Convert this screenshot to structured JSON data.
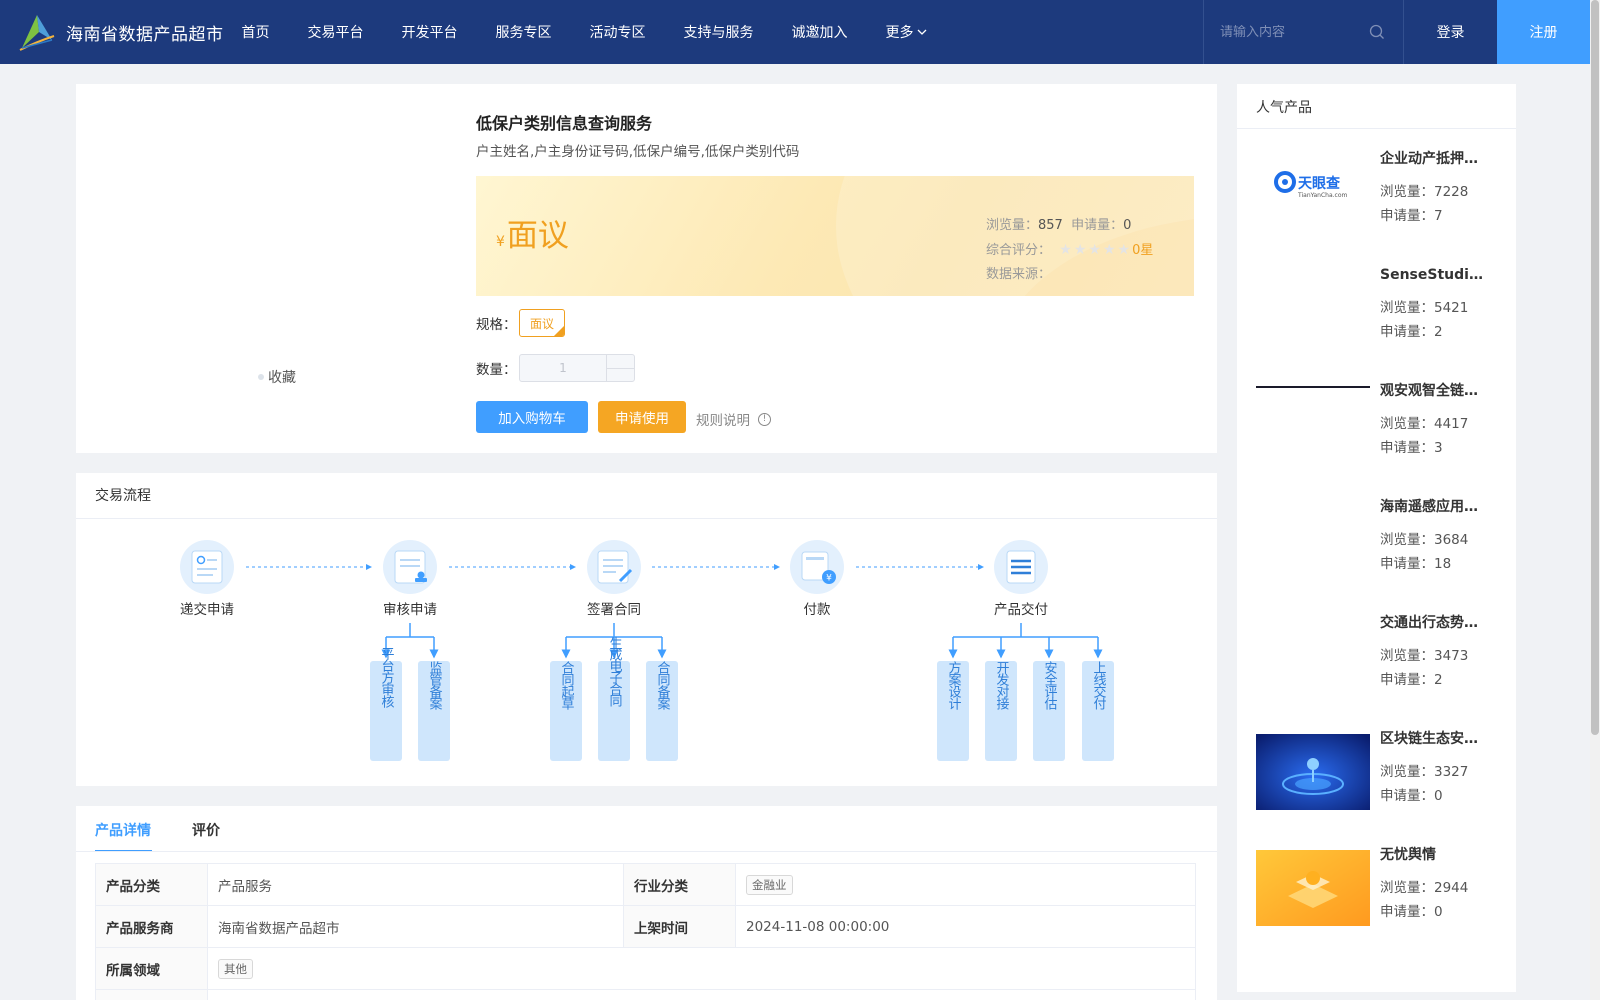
{
  "header": {
    "site_name": "海南省数据产品超市",
    "nav": [
      {
        "label": "首页"
      },
      {
        "label": "交易平台"
      },
      {
        "label": "开发平台"
      },
      {
        "label": "服务专区"
      },
      {
        "label": "活动专区"
      },
      {
        "label": "支持与服务"
      },
      {
        "label": "诚邀加入"
      },
      {
        "label": "更多"
      }
    ],
    "search_placeholder": "请输入内容",
    "login": "登录",
    "register": "注册"
  },
  "product": {
    "favorite": "收藏",
    "title": "低保户类别信息查询服务",
    "fields": "户主姓名,户主身份证号码,低保户编号,低保户类别代码",
    "currency": "¥",
    "price": "面议",
    "views_label": "浏览量：",
    "views": "857",
    "applications_label": "申请量：",
    "applications": "0",
    "rating_label": "综合评分：",
    "rating_text": "0星",
    "rating_value": 0,
    "source_label": "数据来源：",
    "spec_label": "规格：",
    "spec_value": "面议",
    "qty_label": "数量：",
    "qty_value": "1",
    "btn_cart": "加入购物车",
    "btn_apply": "申请使用",
    "rules": "规则说明"
  },
  "flow": {
    "title": "交易流程",
    "steps": [
      "递交申请",
      "审核申请",
      "签署合同",
      "付款",
      "产品交付"
    ],
    "substeps": {
      "review": [
        "平台方审核",
        "监管备案"
      ],
      "contract": [
        "合同起草",
        "生成电子合同",
        "合同备案"
      ],
      "delivery": [
        "方案设计",
        "开发对接",
        "安全评估",
        "上线交付"
      ]
    }
  },
  "detail": {
    "tabs": [
      "产品详情",
      "评价"
    ],
    "rows": {
      "category_label": "产品分类",
      "category_value": "产品服务",
      "industry_label": "行业分类",
      "industry_value": "金融业",
      "provider_label": "产品服务商",
      "provider_value": "海南省数据产品超市",
      "listed_label": "上架时间",
      "listed_value": "2024-11-08 00:00:00",
      "domain_label": "所属领域",
      "domain_value": "其他"
    }
  },
  "sidebar": {
    "title": "人气产品",
    "views_label": "浏览量：",
    "apps_label": "申请量：",
    "items": [
      {
        "name": "企业动产抵押信息查询",
        "views": "7228",
        "apps": "7",
        "thumb_text": "天眼查",
        "thumb_sub": "TianYanCha.com"
      },
      {
        "name": "SenseStudio人工智能",
        "views": "5421",
        "apps": "2"
      },
      {
        "name": "观安观智全链路安全",
        "views": "4417",
        "apps": "3"
      },
      {
        "name": "海南遥感应用服务",
        "views": "3684",
        "apps": "18"
      },
      {
        "name": "交通出行态势分析",
        "views": "3473",
        "apps": "2"
      },
      {
        "name": "区块链生态安全服务",
        "views": "3327",
        "apps": "0"
      },
      {
        "name": "无忧舆情",
        "views": "2944",
        "apps": "0"
      }
    ]
  },
  "colors": {
    "header_bg": "#1d3a7d",
    "primary": "#409eff",
    "accent": "#f5a623"
  }
}
